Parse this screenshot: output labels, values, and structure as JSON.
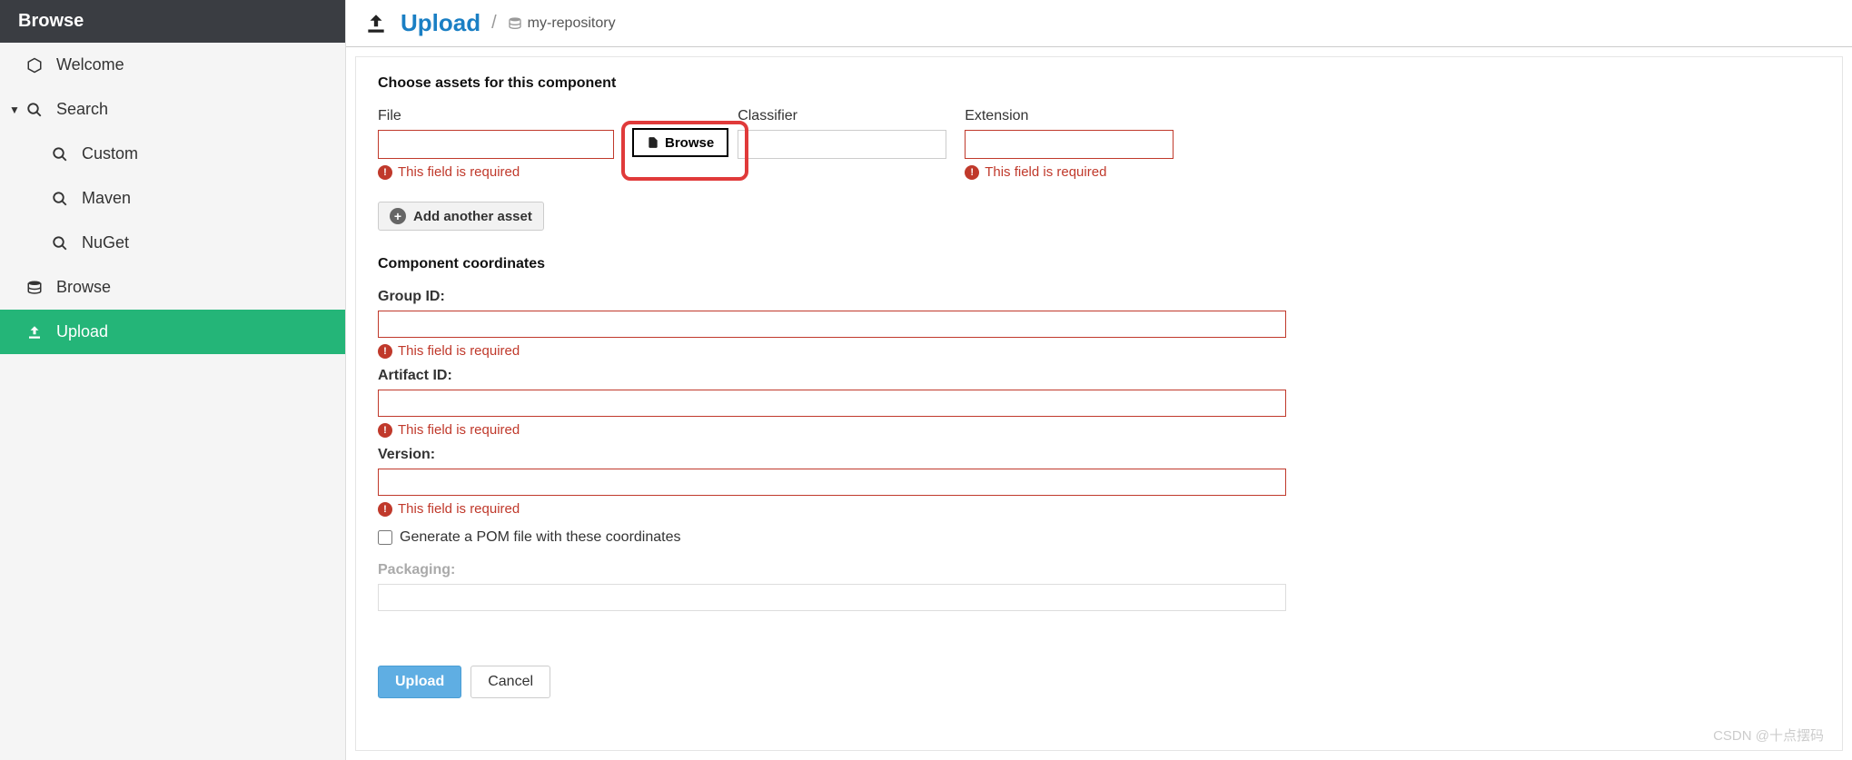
{
  "sidebar": {
    "header": "Browse",
    "items": [
      {
        "label": "Welcome",
        "icon": "hexagon-icon"
      },
      {
        "label": "Search",
        "icon": "search-icon",
        "expanded": true
      },
      {
        "label": "Custom",
        "icon": "search-icon",
        "indent": true
      },
      {
        "label": "Maven",
        "icon": "search-icon",
        "indent": true
      },
      {
        "label": "NuGet",
        "icon": "search-icon",
        "indent": true
      },
      {
        "label": "Browse",
        "icon": "database-icon"
      },
      {
        "label": "Upload",
        "icon": "upload-icon",
        "active": true
      }
    ]
  },
  "breadcrumb": {
    "title": "Upload",
    "repo": "my-repository"
  },
  "assets": {
    "section_title": "Choose assets for this component",
    "file_label": "File",
    "classifier_label": "Classifier",
    "extension_label": "Extension",
    "browse_label": "Browse",
    "required_msg": "This field is required",
    "add_another_label": "Add another asset"
  },
  "coords": {
    "section_title": "Component coordinates",
    "group_label": "Group ID:",
    "artifact_label": "Artifact ID:",
    "version_label": "Version:",
    "required_msg": "This field is required",
    "pom_checkbox_label": "Generate a POM file with these coordinates",
    "packaging_label": "Packaging:"
  },
  "actions": {
    "upload_label": "Upload",
    "cancel_label": "Cancel"
  },
  "watermark": "CSDN @十点摆码"
}
